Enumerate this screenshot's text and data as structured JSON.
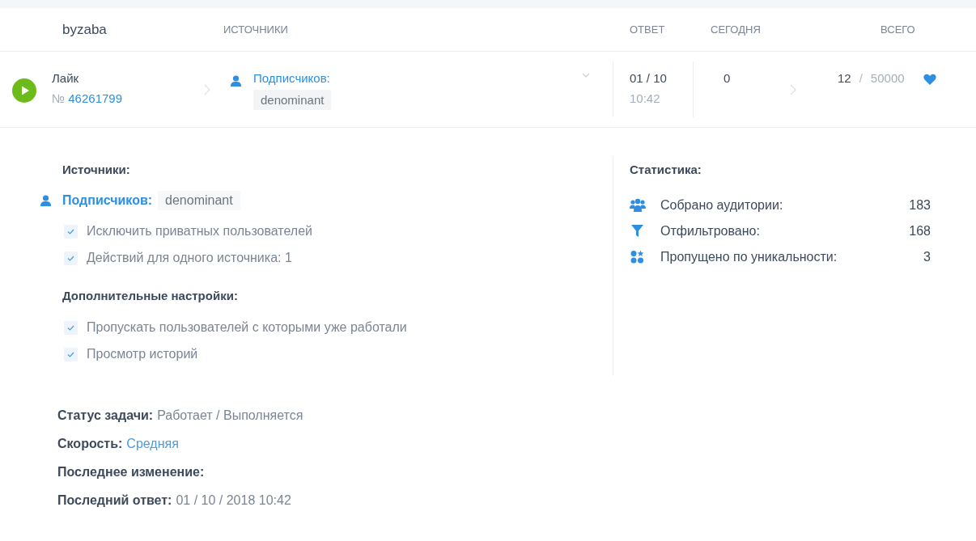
{
  "header": {
    "title": "byzaba",
    "columns": [
      "ИСТОЧНИКИ",
      "ОТВЕТ",
      "СЕГОДНЯ",
      "ВСЕГО"
    ]
  },
  "task": {
    "running": true,
    "type": "Лайк",
    "number_prefix": "№",
    "number": "46261799",
    "source": {
      "label": "Подписчиков:",
      "value": "denominant"
    },
    "answer_date": "01 / 10",
    "answer_time": "10:42",
    "today": "0",
    "total": "12",
    "separator": "/",
    "limit": "50000",
    "liked": true
  },
  "details": {
    "sources_title": "Источники:",
    "source": {
      "label": "Подписчиков:",
      "value": "denominant"
    },
    "options": [
      {
        "label": "Исключить приватных пользователей",
        "checked": true
      },
      {
        "label": "Действий для одного источника: 1",
        "checked": true
      }
    ],
    "extra_title": "Дополнительные настройки:",
    "extra_options": [
      {
        "label": "Пропускать пользователей с которыми уже работали",
        "checked": true
      },
      {
        "label": "Просмотр историй",
        "checked": true
      }
    ]
  },
  "stats": {
    "title": "Статистика:",
    "items": [
      {
        "kind": "audience",
        "label": "Собрано аудитории:",
        "value": "183"
      },
      {
        "kind": "filter",
        "label": "Отфильтровано:",
        "value": "168"
      },
      {
        "kind": "unique",
        "label": "Пропущено по уникальности:",
        "value": "3"
      }
    ]
  },
  "info": [
    {
      "kind": "plain",
      "label": "Статус задачи:",
      "value": "Работает / Выполняется"
    },
    {
      "kind": "link",
      "label": "Скорость:",
      "value": "Средняя"
    },
    {
      "label": "Последнее изменение:"
    },
    {
      "kind": "plain",
      "label": "Последний ответ:",
      "value": "01 / 10 / 2018 10:42"
    }
  ]
}
